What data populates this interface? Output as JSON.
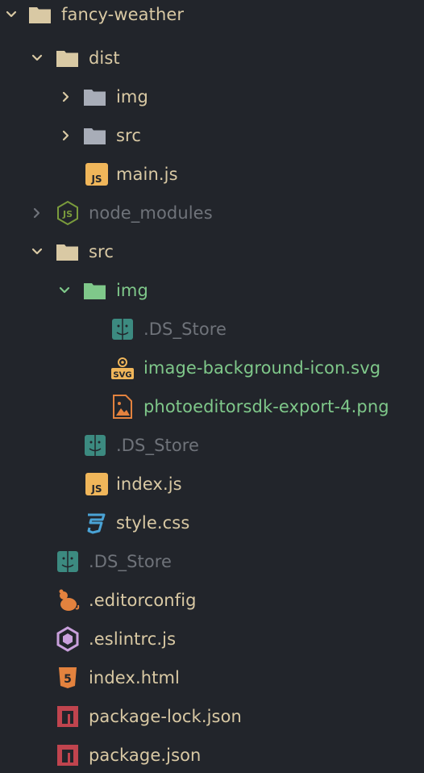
{
  "colors": {
    "background": "#22252b",
    "text": "#d9c9a4",
    "text_dim": "#6f737a",
    "text_green": "#7fc88a",
    "folder_tan": "#d9c9a4",
    "folder_gray": "#a8adb8",
    "folder_green": "#7fc88a",
    "js_yellow": "#f0b65a",
    "css_blue": "#4aa3d6",
    "html_orange": "#e3823e",
    "npm_red": "#c0444e",
    "finder_teal": "#3c8a80",
    "node_green": "#7a9b3c",
    "eslint_purple": "#c9a0dc"
  },
  "tree": [
    {
      "name": "fancy-weather",
      "kind": "folder",
      "expanded": true,
      "icon": "folder-icon"
    },
    {
      "name": "dist",
      "kind": "folder",
      "expanded": true,
      "icon": "folder-icon"
    },
    {
      "name": "img",
      "kind": "folder",
      "expanded": false,
      "icon": "folder-icon"
    },
    {
      "name": "src",
      "kind": "folder",
      "expanded": false,
      "icon": "folder-icon"
    },
    {
      "name": "main.js",
      "kind": "file",
      "icon": "javascript-icon"
    },
    {
      "name": "node_modules",
      "kind": "folder",
      "expanded": false,
      "icon": "nodejs-icon",
      "status": "ignored"
    },
    {
      "name": "src",
      "kind": "folder",
      "expanded": true,
      "icon": "folder-icon"
    },
    {
      "name": "img",
      "kind": "folder",
      "expanded": true,
      "icon": "folder-icon",
      "status": "untracked"
    },
    {
      "name": ".DS_Store",
      "kind": "file",
      "icon": "finder-icon",
      "status": "ignored"
    },
    {
      "name": "image-background-icon.svg",
      "kind": "file",
      "icon": "svg-icon",
      "status": "untracked"
    },
    {
      "name": "photoeditorsdk-export-4.png",
      "kind": "file",
      "icon": "image-icon",
      "status": "untracked"
    },
    {
      "name": ".DS_Store",
      "kind": "file",
      "icon": "finder-icon",
      "status": "ignored"
    },
    {
      "name": "index.js",
      "kind": "file",
      "icon": "javascript-icon"
    },
    {
      "name": "style.css",
      "kind": "file",
      "icon": "css3-icon"
    },
    {
      "name": ".DS_Store",
      "kind": "file",
      "icon": "finder-icon",
      "status": "ignored"
    },
    {
      "name": ".editorconfig",
      "kind": "file",
      "icon": "editorconfig-icon"
    },
    {
      "name": ".eslintrc.js",
      "kind": "file",
      "icon": "eslint-icon"
    },
    {
      "name": "index.html",
      "kind": "file",
      "icon": "html5-icon"
    },
    {
      "name": "package-lock.json",
      "kind": "file",
      "icon": "npm-icon"
    },
    {
      "name": "package.json",
      "kind": "file",
      "icon": "npm-icon"
    }
  ]
}
